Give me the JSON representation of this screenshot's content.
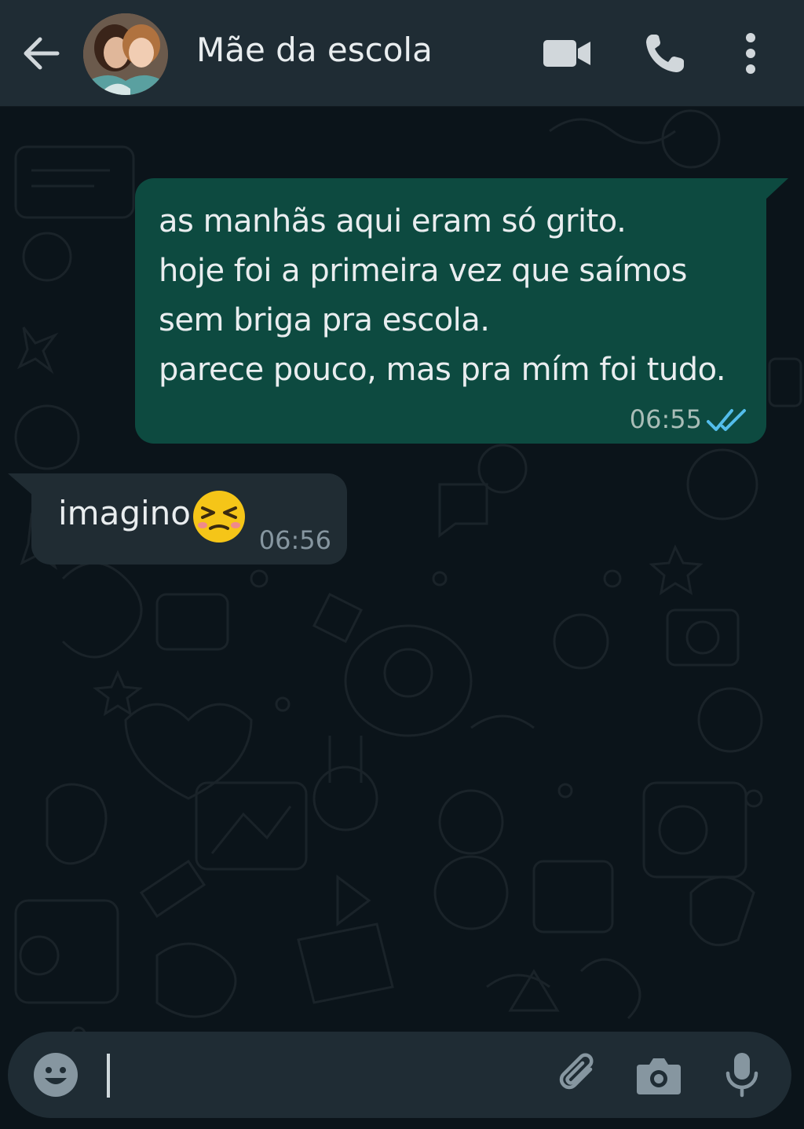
{
  "header": {
    "contact_name": "Mãe da escola",
    "icons": [
      "back-arrow-icon",
      "video-call-icon",
      "voice-call-icon",
      "more-options-icon"
    ]
  },
  "messages": [
    {
      "direction": "outgoing",
      "lines": [
        "as manhãs aqui eram só grito.",
        "hoje foi a primeira vez que saímos",
        "sem briga pra escola.",
        "parece pouco, mas pra mím foi tudo."
      ],
      "time": "06:55",
      "status": "read"
    },
    {
      "direction": "incoming",
      "text": "imagino",
      "emoji": "tired-face-emoji",
      "time": "06:56"
    }
  ],
  "composer": {
    "value": "",
    "icons": [
      "emoji-icon",
      "attach-icon",
      "camera-icon",
      "mic-icon"
    ]
  },
  "colors": {
    "header_bg": "#1f2c34",
    "chat_bg": "#0b141a",
    "outgoing_bubble": "#0d4a40",
    "incoming_bubble": "#202c33",
    "read_tick": "#53bdeb"
  }
}
